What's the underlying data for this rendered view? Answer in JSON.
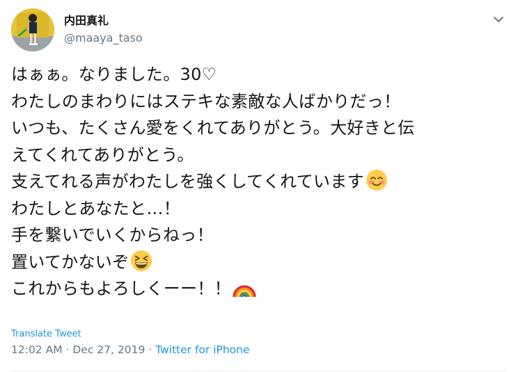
{
  "user": {
    "display_name": "内田真礼",
    "handle": "@maaya_taso"
  },
  "tweet": {
    "lines": [
      {
        "text": "はぁぁ。なりました。30♡",
        "emoji": null
      },
      {
        "text": "わたしのまわりにはステキな素敵な人ばかりだっ！",
        "emoji": null
      },
      {
        "text": "いつも、たくさん愛をくれてありがとう。大好きと伝",
        "emoji": null
      },
      {
        "text": "えてくれてありがとう。",
        "emoji": null
      },
      {
        "text": "支えてれる声がわたしを強くしてくれています",
        "emoji": "smiling-face-with-smiling-eyes-emoji"
      },
      {
        "text": "わたしとあなたと…！",
        "emoji": null
      },
      {
        "text": "手を繋いでいくからねっ！",
        "emoji": null
      },
      {
        "text": "置いてかないぞ",
        "emoji": "grinning-squinting-face-emoji"
      },
      {
        "text": "これからもよろしくーー！！",
        "emoji": "rainbow-emoji"
      }
    ]
  },
  "footer": {
    "translate_label": "Translate Tweet",
    "time": "12:02 AM",
    "separator": " · ",
    "date": "Dec 27, 2019",
    "source": "Twitter for iPhone"
  },
  "icons": {
    "menu": "chevron-down-icon",
    "avatar": "profile-photo"
  },
  "colors": {
    "text": "#14171a",
    "secondary": "#657786",
    "link": "#1b95e0",
    "divider": "#e6ecf0"
  }
}
